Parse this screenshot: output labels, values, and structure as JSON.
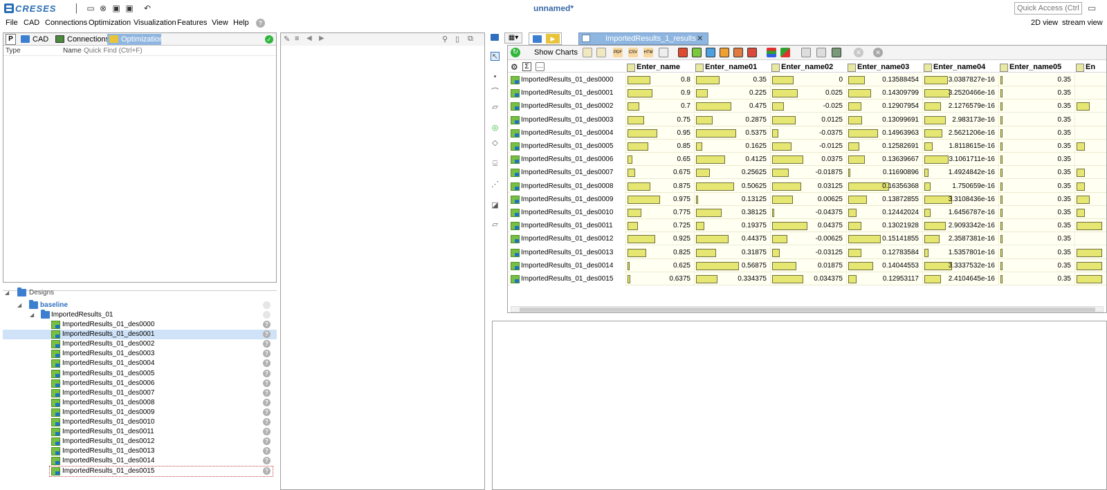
{
  "app": {
    "logo_text": "CRESES",
    "title": "unnamed*",
    "quick_access_placeholder": "Quick Access (Ctrl+Q)",
    "view_2d": "2D view",
    "view_stream": "stream view"
  },
  "menu": [
    "File",
    "CAD",
    "Connections",
    "Optimization",
    "Visualization",
    "Features",
    "View",
    "Help"
  ],
  "left_tabs": {
    "p_label": "P",
    "cad": "CAD",
    "connections": "Connections",
    "optimization": "Optimization"
  },
  "tree_header": {
    "type": "Type",
    "name": "Name",
    "quick_find": "Quick Find (Ctrl+F)"
  },
  "designs": {
    "root": "Designs",
    "baseline": "baseline",
    "folder": "ImportedResults_01",
    "items": [
      "ImportedResults_01_des0000",
      "ImportedResults_01_des0001",
      "ImportedResults_01_des0002",
      "ImportedResults_01_des0003",
      "ImportedResults_01_des0004",
      "ImportedResults_01_des0005",
      "ImportedResults_01_des0006",
      "ImportedResults_01_des0007",
      "ImportedResults_01_des0008",
      "ImportedResults_01_des0009",
      "ImportedResults_01_des0010",
      "ImportedResults_01_des0011",
      "ImportedResults_01_des0012",
      "ImportedResults_01_des0013",
      "ImportedResults_01_des0014",
      "ImportedResults_01_des0015"
    ],
    "selected_index": 1
  },
  "results": {
    "tab_label": "ImportedResults_1_results",
    "show_charts": "Show Charts",
    "columns": [
      "Enter_name",
      "Enter_name01",
      "Enter_name02",
      "Enter_name03",
      "Enter_name04",
      "Enter_name05",
      "En"
    ],
    "rows": [
      {
        "name": "ImportedResults_01_des0000",
        "v": [
          "0.8",
          "0.35",
          "0",
          "0.13588454",
          "3.0387827e-16",
          "0.35"
        ],
        "b": [
          0.53,
          0.55,
          0.5,
          0.38,
          0.55,
          0.05,
          0.0
        ]
      },
      {
        "name": "ImportedResults_01_des0001",
        "v": [
          "0.9",
          "0.225",
          "0.025",
          "0.14309799",
          "3.2520466e-16",
          "0.35"
        ],
        "b": [
          0.58,
          0.27,
          0.6,
          0.53,
          0.6,
          0.05,
          0.0
        ]
      },
      {
        "name": "ImportedResults_01_des0002",
        "v": [
          "0.7",
          "0.475",
          "-0.025",
          "0.12907954",
          "2.1276579e-16",
          "0.35"
        ],
        "b": [
          0.28,
          0.82,
          0.28,
          0.3,
          0.38,
          0.05,
          0.3
        ]
      },
      {
        "name": "ImportedResults_01_des0003",
        "v": [
          "0.75",
          "0.2875",
          "0.0125",
          "0.13099691",
          "2.983173e-16",
          "0.35"
        ],
        "b": [
          0.38,
          0.38,
          0.55,
          0.33,
          0.5,
          0.05,
          0.0
        ]
      },
      {
        "name": "ImportedResults_01_des0004",
        "v": [
          "0.95",
          "0.5375",
          "-0.0375",
          "0.14963963",
          "2.5621206e-16",
          "0.35"
        ],
        "b": [
          0.7,
          0.93,
          0.15,
          0.7,
          0.42,
          0.05,
          0.0
        ]
      },
      {
        "name": "ImportedResults_01_des0005",
        "v": [
          "0.85",
          "0.1625",
          "-0.0125",
          "0.12582691",
          "1.8118615e-16",
          "0.35"
        ],
        "b": [
          0.48,
          0.14,
          0.45,
          0.25,
          0.2,
          0.05,
          0.2
        ]
      },
      {
        "name": "ImportedResults_01_des0006",
        "v": [
          "0.65",
          "0.4125",
          "0.0375",
          "0.13639667",
          "3.1061711e-16",
          "0.35"
        ],
        "b": [
          0.12,
          0.67,
          0.72,
          0.38,
          0.57,
          0.05,
          0.0
        ]
      },
      {
        "name": "ImportedResults_01_des0007",
        "v": [
          "0.675",
          "0.25625",
          "-0.01875",
          "0.11690896",
          "1.4924842e-16",
          "0.35"
        ],
        "b": [
          0.18,
          0.32,
          0.38,
          0.05,
          0.1,
          0.05,
          0.2
        ]
      },
      {
        "name": "ImportedResults_01_des0008",
        "v": [
          "0.875",
          "0.50625",
          "0.03125",
          "0.16356368",
          "1.750659e-16",
          "0.35"
        ],
        "b": [
          0.53,
          0.88,
          0.67,
          0.95,
          0.15,
          0.05,
          0.2
        ]
      },
      {
        "name": "ImportedResults_01_des0009",
        "v": [
          "0.975",
          "0.13125",
          "0.00625",
          "0.13872855",
          "3.3108436e-16",
          "0.35"
        ],
        "b": [
          0.75,
          0.05,
          0.48,
          0.43,
          0.65,
          0.05,
          0.3
        ]
      },
      {
        "name": "ImportedResults_01_des0010",
        "v": [
          "0.775",
          "0.38125",
          "-0.04375",
          "0.12442024",
          "1.6456787e-16",
          "0.35"
        ],
        "b": [
          0.33,
          0.6,
          0.05,
          0.2,
          0.15,
          0.05,
          0.2
        ]
      },
      {
        "name": "ImportedResults_01_des0011",
        "v": [
          "0.725",
          "0.19375",
          "0.04375",
          "0.13021928",
          "2.9093342e-16",
          "0.35"
        ],
        "b": [
          0.24,
          0.2,
          0.82,
          0.3,
          0.5,
          0.05,
          0.6
        ]
      },
      {
        "name": "ImportedResults_01_des0012",
        "v": [
          "0.925",
          "0.44375",
          "-0.00625",
          "0.15141855",
          "2.3587381e-16",
          "0.35"
        ],
        "b": [
          0.65,
          0.75,
          0.35,
          0.75,
          0.35,
          0.05,
          0.0
        ]
      },
      {
        "name": "ImportedResults_01_des0013",
        "v": [
          "0.825",
          "0.31875",
          "-0.03125",
          "0.12783584",
          "1.5357801e-16",
          "0.35"
        ],
        "b": [
          0.44,
          0.47,
          0.18,
          0.3,
          0.1,
          0.05,
          0.6
        ]
      },
      {
        "name": "ImportedResults_01_des0014",
        "v": [
          "0.625",
          "0.56875",
          "0.01875",
          "0.14044553",
          "3.3337532e-16",
          "0.35"
        ],
        "b": [
          0.05,
          1.0,
          0.57,
          0.58,
          0.65,
          0.05,
          0.6
        ]
      },
      {
        "name": "ImportedResults_01_des0015",
        "v": [
          "0.6375",
          "0.334375",
          "0.034375",
          "0.12953117",
          "2.4104645e-16",
          "0.35"
        ],
        "b": [
          0.07,
          0.5,
          0.72,
          0.2,
          0.38,
          0.05,
          0.6
        ]
      }
    ]
  },
  "colors": {
    "accent_blue": "#3c7fd0",
    "bar_fill": "#e6e673",
    "tab_blue": "#8fb6e0",
    "design_green": "#78c043"
  }
}
